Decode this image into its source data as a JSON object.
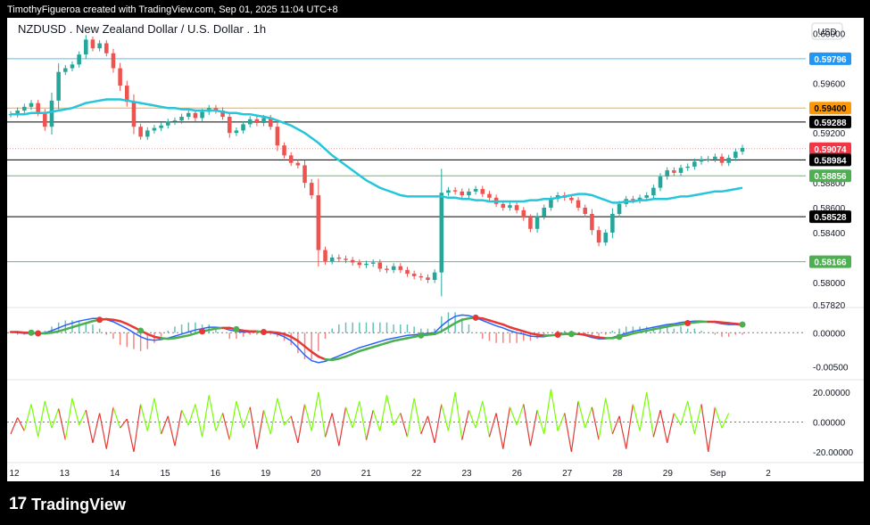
{
  "header": {
    "attribution": "TimothyFigueroa created with TradingView.com, Sep 01, 2025 11:04 UTC+8"
  },
  "footer": {
    "logo_mark": "17",
    "logo_text": "TradingView"
  },
  "chart_data": {
    "type": "line",
    "title": "NZDUSD . New Zealand Dollar / U.S. Dollar . 1h",
    "currency": "USD",
    "x_ticks": [
      "12",
      "13",
      "14",
      "15",
      "16",
      "19",
      "20",
      "21",
      "22",
      "23",
      "26",
      "27",
      "28",
      "29",
      "Sep",
      "2"
    ],
    "price_axis": {
      "ticks": [
        "0.60000",
        "0.59600",
        "0.59200",
        "0.58800",
        "0.58600",
        "0.58400",
        "0.58000",
        "0.57820"
      ],
      "ylim": [
        0.5782,
        0.6001
      ]
    },
    "price": {
      "name": "NZDUSD",
      "values": [
        0.5935,
        0.5938,
        0.5941,
        0.5944,
        0.5936,
        0.5925,
        0.5946,
        0.5969,
        0.5972,
        0.5975,
        0.5983,
        0.5995,
        0.5988,
        0.5992,
        0.5984,
        0.5972,
        0.5958,
        0.5945,
        0.5925,
        0.5917,
        0.5922,
        0.5924,
        0.5926,
        0.5929,
        0.593,
        0.5933,
        0.5936,
        0.5932,
        0.5937,
        0.594,
        0.5938,
        0.5933,
        0.592,
        0.5922,
        0.5927,
        0.5931,
        0.5928,
        0.5932,
        0.5925,
        0.591,
        0.5902,
        0.5896,
        0.5894,
        0.588,
        0.587,
        0.5826,
        0.5817,
        0.582,
        0.5819,
        0.5818,
        0.5816,
        0.5814,
        0.5815,
        0.5816,
        0.5811,
        0.581,
        0.5813,
        0.581,
        0.5807,
        0.5805,
        0.5804,
        0.5802,
        0.5808,
        0.5872,
        0.5874,
        0.5873,
        0.587,
        0.5873,
        0.5875,
        0.5871,
        0.5868,
        0.5863,
        0.586,
        0.5862,
        0.5858,
        0.5852,
        0.5843,
        0.5853,
        0.586,
        0.5867,
        0.587,
        0.5868,
        0.5866,
        0.586,
        0.5855,
        0.5842,
        0.5832,
        0.584,
        0.5855,
        0.5863,
        0.5867,
        0.5866,
        0.5868,
        0.587,
        0.5876,
        0.5885,
        0.589,
        0.5888,
        0.5892,
        0.5893,
        0.5897,
        0.5899,
        0.5899,
        0.5901,
        0.5896,
        0.59,
        0.5905,
        0.5908
      ],
      "color_up": "#26a69a",
      "color_down": "#ef5350"
    },
    "ma": {
      "values": [
        0.5935,
        0.5935,
        0.5935,
        0.5936,
        0.5936,
        0.5936,
        0.5937,
        0.5938,
        0.5939,
        0.594,
        0.5942,
        0.5944,
        0.5945,
        0.5946,
        0.5947,
        0.5947,
        0.5947,
        0.5946,
        0.5945,
        0.5944,
        0.5943,
        0.5942,
        0.5941,
        0.594,
        0.594,
        0.5939,
        0.5939,
        0.5938,
        0.5938,
        0.5938,
        0.5938,
        0.5937,
        0.5936,
        0.5936,
        0.5935,
        0.5935,
        0.5934,
        0.5933,
        0.5932,
        0.593,
        0.5928,
        0.5926,
        0.5923,
        0.592,
        0.5916,
        0.5912,
        0.5907,
        0.5902,
        0.5898,
        0.5894,
        0.589,
        0.5886,
        0.5882,
        0.5879,
        0.5876,
        0.5874,
        0.5872,
        0.587,
        0.5869,
        0.5869,
        0.5869,
        0.5869,
        0.5869,
        0.5869,
        0.5868,
        0.5868,
        0.5867,
        0.5867,
        0.5866,
        0.5866,
        0.5865,
        0.5865,
        0.5865,
        0.5865,
        0.5865,
        0.5865,
        0.5866,
        0.5866,
        0.5867,
        0.5867,
        0.5868,
        0.5869,
        0.587,
        0.5871,
        0.5871,
        0.587,
        0.5868,
        0.5866,
        0.5864,
        0.5864,
        0.5865,
        0.5865,
        0.5866,
        0.5866,
        0.5867,
        0.5867,
        0.5867,
        0.5868,
        0.5869,
        0.5869,
        0.587,
        0.5871,
        0.5872,
        0.5873,
        0.5873,
        0.5874,
        0.5875,
        0.5876
      ],
      "color": "#26c6da"
    },
    "levels": [
      {
        "value": 0.59796,
        "label": "0.59796",
        "line_color": "#4fc3f7",
        "tag_color": "#2196f3",
        "text_color": "#ffffff"
      },
      {
        "value": 0.594,
        "label": "0.59400",
        "line_color": "#ffa726",
        "tag_color": "#ff9800",
        "text_color": "#000000"
      },
      {
        "value": 0.59288,
        "label": "0.59288",
        "line_color": "#000000",
        "tag_color": "#000000",
        "text_color": "#ffffff"
      },
      {
        "value": 0.59074,
        "label": "0.59074",
        "line_color": "#ef9a9a",
        "tag_color": "#f23645",
        "text_color": "#ffffff",
        "dotted": true
      },
      {
        "value": 0.58984,
        "label": "0.58984",
        "line_color": "#000000",
        "tag_color": "#000000",
        "text_color": "#ffffff"
      },
      {
        "value": 0.58856,
        "label": "0.58856",
        "line_color": "#66bb6a",
        "tag_color": "#4caf50",
        "text_color": "#ffffff"
      },
      {
        "value": 0.58528,
        "label": "0.58528",
        "line_color": "#000000",
        "tag_color": "#000000",
        "text_color": "#ffffff"
      },
      {
        "value": 0.58166,
        "label": "0.58166",
        "line_color": "#66bb6a",
        "tag_color": "#4caf50",
        "text_color": "#ffffff"
      }
    ],
    "macd": {
      "ticks": [
        "0.00000",
        "-0.00500"
      ],
      "ylim": [
        -0.0065,
        0.0033
      ],
      "macd_values": [
        0.0001,
        0.0,
        -0.0001,
        -0.0001,
        -0.0001,
        0.0,
        0.0003,
        0.0007,
        0.0011,
        0.0014,
        0.0017,
        0.0019,
        0.0021,
        0.0021,
        0.0019,
        0.0016,
        0.0011,
        0.0006,
        0.0,
        -0.0006,
        -0.001,
        -0.0011,
        -0.001,
        -0.0008,
        -0.0005,
        -0.0002,
        0.0001,
        0.0004,
        0.0006,
        0.0008,
        0.0008,
        0.0007,
        0.0004,
        0.0002,
        0.0001,
        0.0001,
        0.0001,
        0.0001,
        0.0,
        -0.0002,
        -0.0006,
        -0.0012,
        -0.0022,
        -0.0033,
        -0.0041,
        -0.0044,
        -0.0042,
        -0.0038,
        -0.0034,
        -0.003,
        -0.0026,
        -0.0022,
        -0.0019,
        -0.0016,
        -0.0013,
        -0.001,
        -0.0008,
        -0.0006,
        -0.0004,
        -0.0003,
        -0.0002,
        -0.0001,
        0.0,
        0.001,
        0.0018,
        0.0024,
        0.0026,
        0.0025,
        0.0022,
        0.0018,
        0.0014,
        0.001,
        0.0007,
        0.0003,
        0.0,
        -0.0002,
        -0.0005,
        -0.0006,
        -0.0006,
        -0.0004,
        -0.0002,
        -0.0001,
        -0.0001,
        -0.0002,
        -0.0004,
        -0.0007,
        -0.0009,
        -0.0009,
        -0.0007,
        -0.0004,
        -0.0001,
        0.0002,
        0.0004,
        0.0006,
        0.0008,
        0.001,
        0.0012,
        0.0013,
        0.0015,
        0.0016,
        0.0017,
        0.0017,
        0.0016,
        0.0015,
        0.0013,
        0.0012,
        0.0012,
        0.0011
      ],
      "signal_values": [
        0.0001,
        0.0001,
        0.0,
        0.0,
        -0.0001,
        -0.0001,
        0.0,
        0.0002,
        0.0005,
        0.0008,
        0.0011,
        0.0014,
        0.0017,
        0.0019,
        0.002,
        0.0019,
        0.0017,
        0.0013,
        0.0008,
        0.0003,
        -0.0002,
        -0.0006,
        -0.0008,
        -0.0009,
        -0.0008,
        -0.0006,
        -0.0004,
        -0.0001,
        0.0002,
        0.0004,
        0.0006,
        0.0007,
        0.0007,
        0.0005,
        0.0003,
        0.0002,
        0.0002,
        0.0001,
        0.0001,
        0.0,
        -0.0002,
        -0.0006,
        -0.0012,
        -0.002,
        -0.0028,
        -0.0035,
        -0.0039,
        -0.004,
        -0.0038,
        -0.0035,
        -0.0031,
        -0.0027,
        -0.0024,
        -0.0021,
        -0.0018,
        -0.0015,
        -0.0012,
        -0.001,
        -0.0008,
        -0.0006,
        -0.0004,
        -0.0003,
        -0.0002,
        0.0002,
        0.0008,
        0.0014,
        0.0019,
        0.0021,
        0.0022,
        0.0021,
        0.0018,
        0.0015,
        0.0012,
        0.0008,
        0.0005,
        0.0002,
        -0.0001,
        -0.0003,
        -0.0004,
        -0.0004,
        -0.0003,
        -0.0002,
        -0.0002,
        -0.0002,
        -0.0003,
        -0.0005,
        -0.0007,
        -0.0008,
        -0.0008,
        -0.0006,
        -0.0004,
        -0.0001,
        0.0001,
        0.0003,
        0.0005,
        0.0007,
        0.0009,
        0.0011,
        0.0012,
        0.0014,
        0.0015,
        0.0016,
        0.0016,
        0.0016,
        0.0015,
        0.0014,
        0.0013,
        0.0012
      ],
      "cross_up": [
        3,
        19,
        33,
        60,
        82,
        89,
        107
      ],
      "cross_down": [
        4,
        13,
        28,
        37,
        68,
        80,
        99
      ],
      "up_color": "#4caf50",
      "down_color": "#e53935",
      "macd_color": "#2962ff",
      "signal_color": "#ff6d00"
    },
    "oscillator": {
      "ticks": [
        "20.00000",
        "0.00000",
        "-20.00000"
      ],
      "ylim": [
        -26,
        26
      ],
      "values": [
        -8,
        3,
        -6,
        12,
        -10,
        14,
        -4,
        9,
        -12,
        16,
        -2,
        8,
        -14,
        6,
        -18,
        10,
        -4,
        2,
        -20,
        12,
        -6,
        16,
        -8,
        4,
        -16,
        8,
        -2,
        12,
        -10,
        18,
        -6,
        6,
        -12,
        14,
        -4,
        10,
        -18,
        8,
        -8,
        16,
        -2,
        4,
        -14,
        12,
        -6,
        20,
        -10,
        6,
        -16,
        10,
        -4,
        14,
        -12,
        8,
        -6,
        18,
        -2,
        6,
        -10,
        16,
        -8,
        4,
        -14,
        12,
        -6,
        20,
        -12,
        8,
        -4,
        14,
        -10,
        6,
        -18,
        10,
        -2,
        12,
        -16,
        8,
        -8,
        22,
        -6,
        6,
        -20,
        14,
        -4,
        10,
        -12,
        16,
        -8,
        4,
        -18,
        12,
        -6,
        20,
        -10,
        8,
        -14,
        6,
        -2,
        14,
        -8,
        12,
        -20,
        10,
        -4,
        6
      ],
      "up_color": "#76ff03",
      "down_color": "#e53935"
    }
  }
}
